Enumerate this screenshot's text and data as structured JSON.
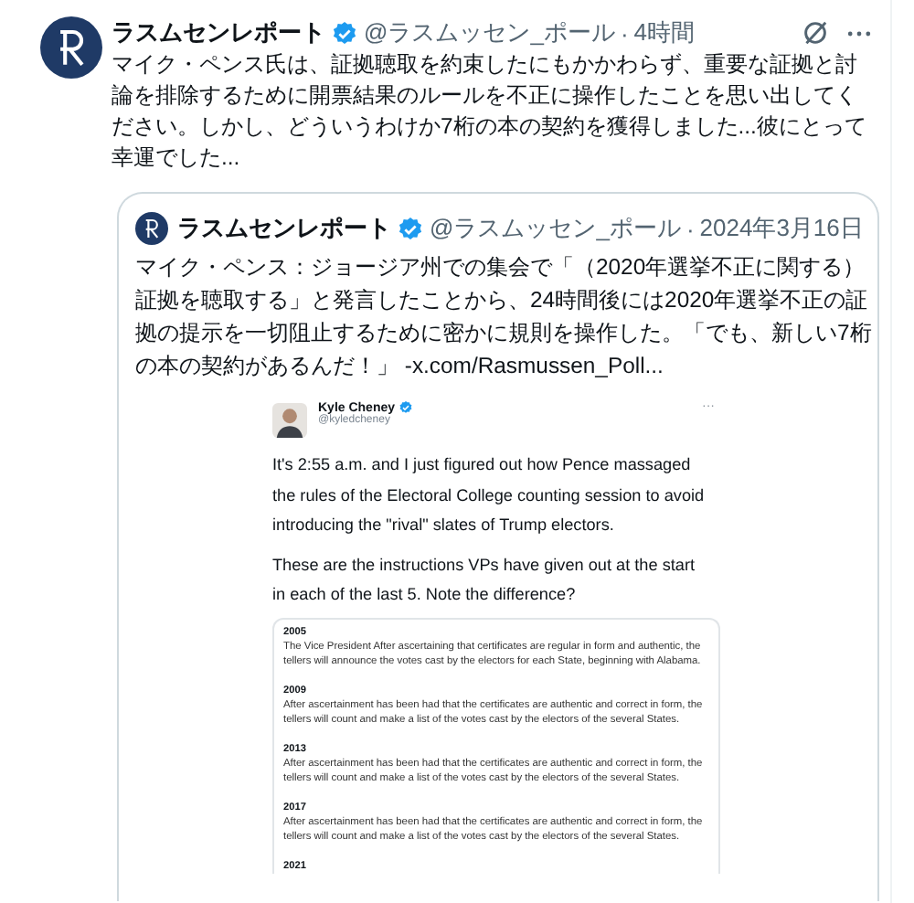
{
  "post": {
    "author": "ラスムセンレポート",
    "verified": true,
    "handle": "@ラスムッセン_ポール",
    "time": "4時間",
    "separator": "·",
    "text": "マイク・ペンス氏は、証拠聴取を約束したにもかかわらず、重要な証拠と討論を排除するために開票結果のルールを不正に操作したことを思い出してください。しかし、どういうわけか7桁の本の契約を獲得しました...彼にとって幸運でした..."
  },
  "quote": {
    "author": "ラスムセンレポート",
    "verified": true,
    "handle": "@ラスムッセン_ポール",
    "separator": "·",
    "date": "2024年3月16日",
    "text": "マイク・ペンス：ジョージア州での集会で「（2020年選挙不正に関する）証拠を聴取する」と発言したことから、24時間後には2020年選挙不正の証拠の提示を一切阻止するために密かに規則を操作した。「でも、新しい7桁の本の契約があるんだ！」",
    "link": "-x.com/Rasmussen_Poll..."
  },
  "embedded_tweet": {
    "author": "Kyle Cheney",
    "verified": true,
    "handle": "@kyledcheney",
    "more": "···",
    "paragraphs": [
      "It's 2:55 a.m. and I just figured out how Pence massaged the rules of the Electoral College counting session to avoid introducing the \"rival\" slates of Trump electors.",
      "These are the instructions VPs have given out at the start in each of the last 5. Note the difference?"
    ],
    "excerpts": [
      {
        "year": "2005",
        "text": "The Vice President After ascertaining that certificates are regular in form and authentic, the tellers will announce the votes cast by the electors for each State, beginning with Alabama."
      },
      {
        "year": "2009",
        "text": "After ascertainment has been had that the certificates are authentic and correct in form, the tellers will count and make a list of the votes cast by the electors of the several States."
      },
      {
        "year": "2013",
        "text": "After ascertainment has been had that the certificates are authentic and correct in form, the tellers will count and make a list of the votes cast by the electors of the several States."
      },
      {
        "year": "2017",
        "text": "After ascertainment has been had that the certificates are authentic and correct in form, the tellers will count and make a list of the votes cast by the electors of the several States."
      },
      {
        "year": "2021"
      }
    ]
  }
}
